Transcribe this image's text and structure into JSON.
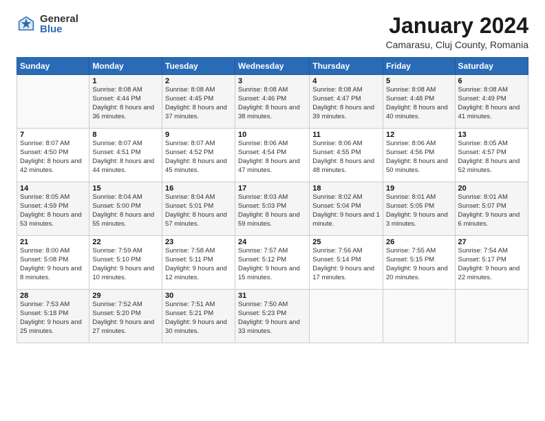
{
  "header": {
    "logo": {
      "general": "General",
      "blue": "Blue"
    },
    "title": "January 2024",
    "subtitle": "Camarasu, Cluj County, Romania"
  },
  "weekdays": [
    "Sunday",
    "Monday",
    "Tuesday",
    "Wednesday",
    "Thursday",
    "Friday",
    "Saturday"
  ],
  "weeks": [
    [
      {
        "day": "",
        "sunrise": "",
        "sunset": "",
        "daylight": ""
      },
      {
        "day": "1",
        "sunrise": "Sunrise: 8:08 AM",
        "sunset": "Sunset: 4:44 PM",
        "daylight": "Daylight: 8 hours and 36 minutes."
      },
      {
        "day": "2",
        "sunrise": "Sunrise: 8:08 AM",
        "sunset": "Sunset: 4:45 PM",
        "daylight": "Daylight: 8 hours and 37 minutes."
      },
      {
        "day": "3",
        "sunrise": "Sunrise: 8:08 AM",
        "sunset": "Sunset: 4:46 PM",
        "daylight": "Daylight: 8 hours and 38 minutes."
      },
      {
        "day": "4",
        "sunrise": "Sunrise: 8:08 AM",
        "sunset": "Sunset: 4:47 PM",
        "daylight": "Daylight: 8 hours and 39 minutes."
      },
      {
        "day": "5",
        "sunrise": "Sunrise: 8:08 AM",
        "sunset": "Sunset: 4:48 PM",
        "daylight": "Daylight: 8 hours and 40 minutes."
      },
      {
        "day": "6",
        "sunrise": "Sunrise: 8:08 AM",
        "sunset": "Sunset: 4:49 PM",
        "daylight": "Daylight: 8 hours and 41 minutes."
      }
    ],
    [
      {
        "day": "7",
        "sunrise": "Sunrise: 8:07 AM",
        "sunset": "Sunset: 4:50 PM",
        "daylight": "Daylight: 8 hours and 42 minutes."
      },
      {
        "day": "8",
        "sunrise": "Sunrise: 8:07 AM",
        "sunset": "Sunset: 4:51 PM",
        "daylight": "Daylight: 8 hours and 44 minutes."
      },
      {
        "day": "9",
        "sunrise": "Sunrise: 8:07 AM",
        "sunset": "Sunset: 4:52 PM",
        "daylight": "Daylight: 8 hours and 45 minutes."
      },
      {
        "day": "10",
        "sunrise": "Sunrise: 8:06 AM",
        "sunset": "Sunset: 4:54 PM",
        "daylight": "Daylight: 8 hours and 47 minutes."
      },
      {
        "day": "11",
        "sunrise": "Sunrise: 8:06 AM",
        "sunset": "Sunset: 4:55 PM",
        "daylight": "Daylight: 8 hours and 48 minutes."
      },
      {
        "day": "12",
        "sunrise": "Sunrise: 8:06 AM",
        "sunset": "Sunset: 4:56 PM",
        "daylight": "Daylight: 8 hours and 50 minutes."
      },
      {
        "day": "13",
        "sunrise": "Sunrise: 8:05 AM",
        "sunset": "Sunset: 4:57 PM",
        "daylight": "Daylight: 8 hours and 52 minutes."
      }
    ],
    [
      {
        "day": "14",
        "sunrise": "Sunrise: 8:05 AM",
        "sunset": "Sunset: 4:59 PM",
        "daylight": "Daylight: 8 hours and 53 minutes."
      },
      {
        "day": "15",
        "sunrise": "Sunrise: 8:04 AM",
        "sunset": "Sunset: 5:00 PM",
        "daylight": "Daylight: 8 hours and 55 minutes."
      },
      {
        "day": "16",
        "sunrise": "Sunrise: 8:04 AM",
        "sunset": "Sunset: 5:01 PM",
        "daylight": "Daylight: 8 hours and 57 minutes."
      },
      {
        "day": "17",
        "sunrise": "Sunrise: 8:03 AM",
        "sunset": "Sunset: 5:03 PM",
        "daylight": "Daylight: 8 hours and 59 minutes."
      },
      {
        "day": "18",
        "sunrise": "Sunrise: 8:02 AM",
        "sunset": "Sunset: 5:04 PM",
        "daylight": "Daylight: 9 hours and 1 minute."
      },
      {
        "day": "19",
        "sunrise": "Sunrise: 8:01 AM",
        "sunset": "Sunset: 5:05 PM",
        "daylight": "Daylight: 9 hours and 3 minutes."
      },
      {
        "day": "20",
        "sunrise": "Sunrise: 8:01 AM",
        "sunset": "Sunset: 5:07 PM",
        "daylight": "Daylight: 9 hours and 6 minutes."
      }
    ],
    [
      {
        "day": "21",
        "sunrise": "Sunrise: 8:00 AM",
        "sunset": "Sunset: 5:08 PM",
        "daylight": "Daylight: 9 hours and 8 minutes."
      },
      {
        "day": "22",
        "sunrise": "Sunrise: 7:59 AM",
        "sunset": "Sunset: 5:10 PM",
        "daylight": "Daylight: 9 hours and 10 minutes."
      },
      {
        "day": "23",
        "sunrise": "Sunrise: 7:58 AM",
        "sunset": "Sunset: 5:11 PM",
        "daylight": "Daylight: 9 hours and 12 minutes."
      },
      {
        "day": "24",
        "sunrise": "Sunrise: 7:57 AM",
        "sunset": "Sunset: 5:12 PM",
        "daylight": "Daylight: 9 hours and 15 minutes."
      },
      {
        "day": "25",
        "sunrise": "Sunrise: 7:56 AM",
        "sunset": "Sunset: 5:14 PM",
        "daylight": "Daylight: 9 hours and 17 minutes."
      },
      {
        "day": "26",
        "sunrise": "Sunrise: 7:55 AM",
        "sunset": "Sunset: 5:15 PM",
        "daylight": "Daylight: 9 hours and 20 minutes."
      },
      {
        "day": "27",
        "sunrise": "Sunrise: 7:54 AM",
        "sunset": "Sunset: 5:17 PM",
        "daylight": "Daylight: 9 hours and 22 minutes."
      }
    ],
    [
      {
        "day": "28",
        "sunrise": "Sunrise: 7:53 AM",
        "sunset": "Sunset: 5:18 PM",
        "daylight": "Daylight: 9 hours and 25 minutes."
      },
      {
        "day": "29",
        "sunrise": "Sunrise: 7:52 AM",
        "sunset": "Sunset: 5:20 PM",
        "daylight": "Daylight: 9 hours and 27 minutes."
      },
      {
        "day": "30",
        "sunrise": "Sunrise: 7:51 AM",
        "sunset": "Sunset: 5:21 PM",
        "daylight": "Daylight: 9 hours and 30 minutes."
      },
      {
        "day": "31",
        "sunrise": "Sunrise: 7:50 AM",
        "sunset": "Sunset: 5:23 PM",
        "daylight": "Daylight: 9 hours and 33 minutes."
      },
      {
        "day": "",
        "sunrise": "",
        "sunset": "",
        "daylight": ""
      },
      {
        "day": "",
        "sunrise": "",
        "sunset": "",
        "daylight": ""
      },
      {
        "day": "",
        "sunrise": "",
        "sunset": "",
        "daylight": ""
      }
    ]
  ]
}
